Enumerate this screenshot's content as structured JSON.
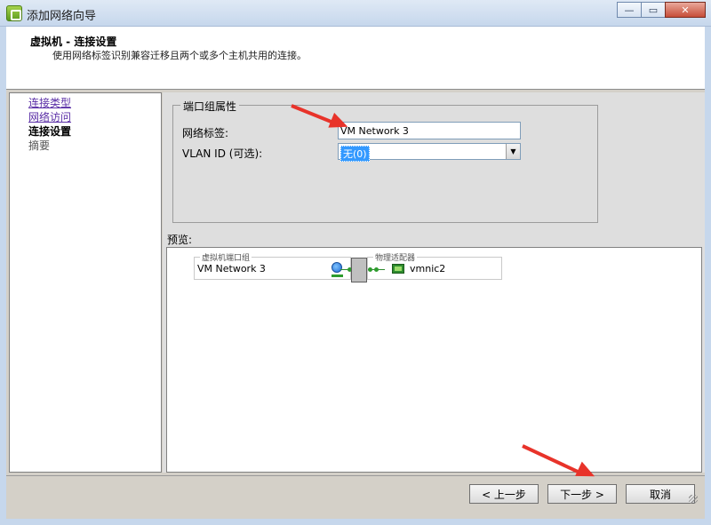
{
  "window": {
    "title": "添加网络向导",
    "minimize_glyph": "—",
    "maximize_glyph": "▭",
    "close_glyph": "✕"
  },
  "header": {
    "title": "虚拟机 - 连接设置",
    "subtitle": "使用网络标签识别兼容迁移且两个或多个主机共用的连接。"
  },
  "nav": {
    "items": [
      {
        "label": "连接类型",
        "state": "link"
      },
      {
        "label": "网络访问",
        "state": "link"
      },
      {
        "label": "连接设置",
        "state": "current"
      },
      {
        "label": "摘要",
        "state": "disabled"
      }
    ]
  },
  "port_group": {
    "legend": "端口组属性",
    "network_label_caption": "网络标签:",
    "network_label_value": "VM Network 3",
    "vlan_caption": "VLAN ID (可选):",
    "vlan_value": "无(0)",
    "dropdown_glyph": "▼"
  },
  "preview": {
    "label": "预览:",
    "vm_port_group_caption": "虚拟机端口组",
    "vm_port_group_name": "VM Network 3",
    "adapter_caption": "物理适配器",
    "adapter_name": "vmnic2"
  },
  "buttons": {
    "back": "< 上一步",
    "next": "下一步 >",
    "cancel": "取消"
  },
  "colors": {
    "annotation_arrow": "#e8332a",
    "link": "#5a2ea6",
    "selection": "#3399ff"
  }
}
